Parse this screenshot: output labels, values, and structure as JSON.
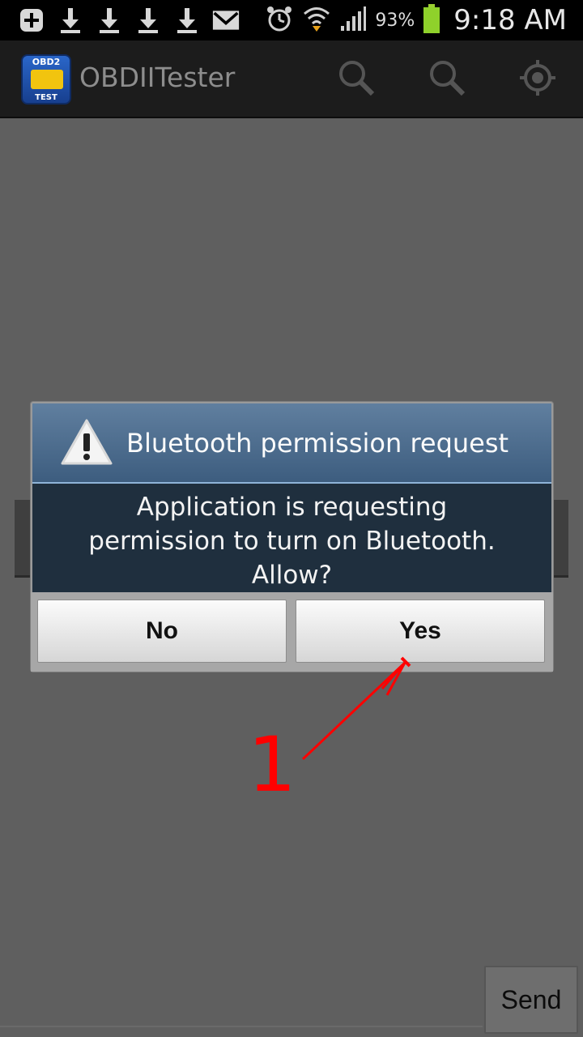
{
  "status_bar": {
    "battery_percent": "93%",
    "time": "9:18 AM",
    "icons": [
      "plus-icon",
      "download-icon",
      "download-icon",
      "download-icon",
      "download-icon",
      "mail-icon",
      "alarm-icon",
      "wifi-icon",
      "signal-icon",
      "battery-icon"
    ]
  },
  "action_bar": {
    "app_icon_top": "OBD2",
    "app_icon_bottom": "TEST",
    "title": "OBDIITester",
    "actions": [
      "search-icon",
      "search-icon",
      "locate-icon"
    ]
  },
  "dialog": {
    "title": "Bluetooth permission request",
    "message_lines": [
      "Application is requesting",
      "permission to turn on Bluetooth.",
      "Allow?"
    ],
    "no_label": "No",
    "yes_label": "Yes"
  },
  "annotation": {
    "number": "1",
    "color": "#ff0000"
  },
  "send_label": "Send",
  "colors": {
    "background": "#5f5f5f",
    "dialog_header": "#4e6e90",
    "dialog_body": "#1f2f3e"
  }
}
